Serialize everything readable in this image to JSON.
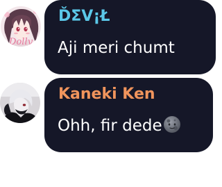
{
  "messages": [
    {
      "sender": "ĎΣV¡Ł",
      "sender_color": "#5bc8e8",
      "text": "Aji meri chumt",
      "avatar_icon": "anime-girl-avatar",
      "avatar_caption": "Dolly"
    },
    {
      "sender": "Kaneki Ken",
      "sender_color": "#f0945c",
      "text": "Ohh, fir dede",
      "avatar_icon": "anime-boy-masked-avatar",
      "emoji": "new-moon-face-emoji"
    }
  ],
  "bubble_color": "#151728"
}
